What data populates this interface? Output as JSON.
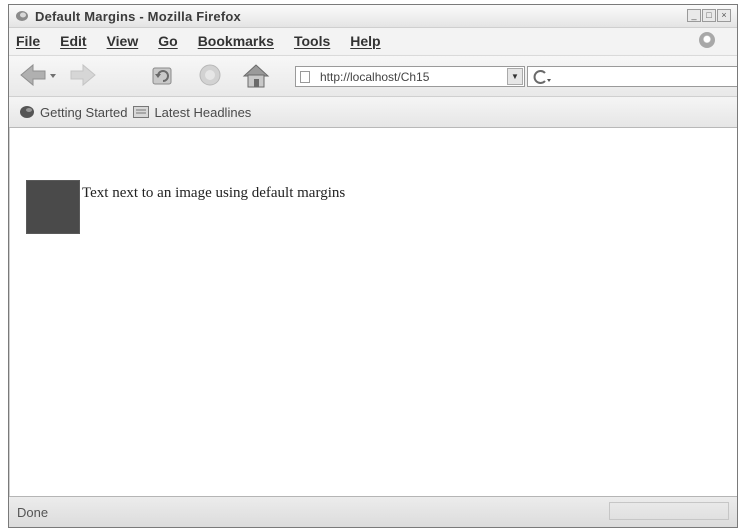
{
  "window": {
    "title": "Default Margins - Mozilla Firefox",
    "controls": {
      "minimize": "_",
      "maximize": "□",
      "close": "×"
    }
  },
  "menubar": {
    "items": [
      {
        "label": "File"
      },
      {
        "label": "Edit"
      },
      {
        "label": "View"
      },
      {
        "label": "Go"
      },
      {
        "label": "Bookmarks"
      },
      {
        "label": "Tools"
      },
      {
        "label": "Help"
      }
    ]
  },
  "navigation": {
    "icons": [
      "back-arrow-icon",
      "forward-arrow-icon",
      "reload-icon",
      "stop-icon",
      "home-icon"
    ],
    "url": "http://localhost/Ch15",
    "dropdown_glyph": "▼"
  },
  "bookmarks": {
    "items": [
      {
        "label": "Getting Started",
        "icon": "getting-started-icon"
      },
      {
        "label": "Latest Headlines",
        "icon": "rss-feed-icon"
      }
    ]
  },
  "page": {
    "text": "Text next to an image using default margins",
    "image_color": "#4a4a4a"
  },
  "status": {
    "text": "Done"
  }
}
